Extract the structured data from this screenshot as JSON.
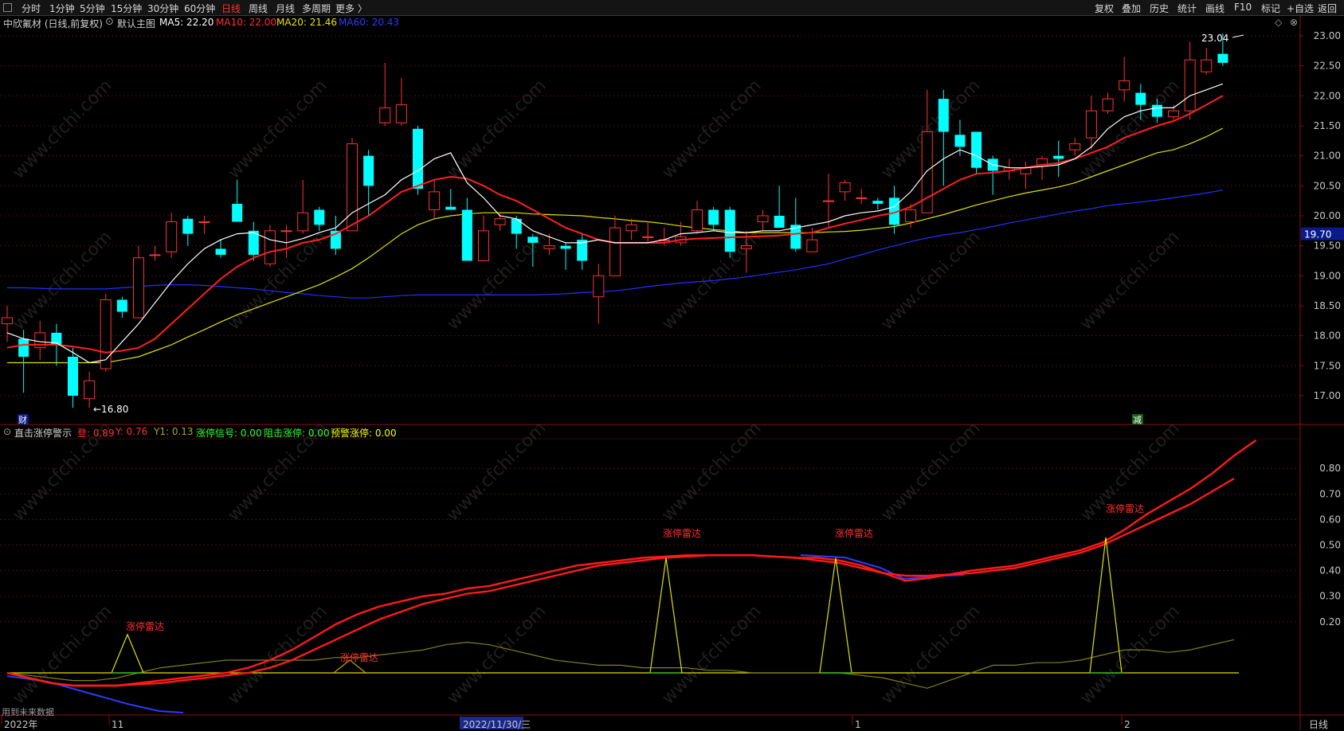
{
  "toolbar": {
    "left": [
      "分时",
      "1分钟",
      "5分钟",
      "15分钟",
      "30分钟",
      "60分钟",
      "日线",
      "周线",
      "月线",
      "多周期",
      "更多 〉"
    ],
    "active": "日线",
    "right": [
      "复权",
      "叠加",
      "历史",
      "统计",
      "画线",
      "F10",
      "标记",
      "+自选",
      "返回"
    ]
  },
  "main_panel": {
    "title": "中欣氟材 (日线,前复权)",
    "indicator": "默认主图",
    "ma5": "MA5: 22.20",
    "ma10": "MA10: 22.00",
    "ma20": "MA20: 21.46",
    "ma60": "MA60: 20.43",
    "price_axis": [
      "23.00",
      "22.50",
      "22.00",
      "21.50",
      "21.00",
      "20.50",
      "20.00",
      "19.50",
      "19.00",
      "18.50",
      "18.00",
      "17.50",
      "17.00"
    ],
    "current_price": "19.70",
    "high_label": "23.04",
    "low_label": "←16.80",
    "markers": [
      "财",
      "减"
    ]
  },
  "sub_panel": {
    "title": "直击涨停警示",
    "params": [
      {
        "text": "登: 0.89",
        "color": "#ff3030"
      },
      {
        "text": "Y: 0.76",
        "color": "#ff3030"
      },
      {
        "text": "Y1: 0.13",
        "color": "#a7a72a"
      },
      {
        "text": "涨停信号: 0.00",
        "color": "#33ff33"
      },
      {
        "text": "阻击涨停: 0.00",
        "color": "#33ff33"
      },
      {
        "text": "预警涨停: 0.00",
        "color": "#ffff00"
      }
    ],
    "axis": [
      "0.80",
      "0.70",
      "0.60",
      "0.50",
      "0.40",
      "0.30",
      "0.20"
    ],
    "signal_label": "涨停雷达",
    "note": "用到未来数据"
  },
  "date_axis": [
    "2022年",
    "11",
    "2022/11/30/三",
    "1",
    "2"
  ],
  "period_badge": "日线",
  "watermark": "www.cfchi.com",
  "colors": {
    "up": "#ff3232",
    "down": "#00ffff",
    "ma5": "#ffffff",
    "ma10": "#ff2020",
    "ma20": "#e0e000",
    "ma60": "#2030ff"
  },
  "chart_data": {
    "type": "candlestick",
    "ylim": [
      16.6,
      23.2
    ],
    "candles": [
      {
        "o": 18.2,
        "c": 18.3,
        "h": 18.5,
        "l": 17.9
      },
      {
        "o": 17.95,
        "c": 17.65,
        "h": 18.1,
        "l": 17.05
      },
      {
        "o": 17.8,
        "c": 18.05,
        "h": 18.25,
        "l": 17.6
      },
      {
        "o": 18.05,
        "c": 17.85,
        "h": 18.2,
        "l": 17.5
      },
      {
        "o": 17.65,
        "c": 17.0,
        "h": 17.8,
        "l": 16.8
      },
      {
        "o": 16.95,
        "c": 17.25,
        "h": 17.4,
        "l": 16.8
      },
      {
        "o": 17.45,
        "c": 18.6,
        "h": 18.7,
        "l": 17.4
      },
      {
        "o": 18.6,
        "c": 18.4,
        "h": 18.65,
        "l": 18.3
      },
      {
        "o": 18.3,
        "c": 19.3,
        "h": 19.5,
        "l": 18.3
      },
      {
        "o": 19.35,
        "c": 19.35,
        "h": 19.5,
        "l": 19.25
      },
      {
        "o": 19.4,
        "c": 19.9,
        "h": 20.05,
        "l": 19.3
      },
      {
        "o": 19.95,
        "c": 19.7,
        "h": 20.0,
        "l": 19.5
      },
      {
        "o": 19.9,
        "c": 19.9,
        "h": 20.0,
        "l": 19.7
      },
      {
        "o": 19.45,
        "c": 19.35,
        "h": 19.6,
        "l": 19.3
      },
      {
        "o": 20.2,
        "c": 19.9,
        "h": 20.6,
        "l": 19.9
      },
      {
        "o": 19.75,
        "c": 19.35,
        "h": 19.9,
        "l": 19.25
      },
      {
        "o": 19.2,
        "c": 19.75,
        "h": 19.85,
        "l": 19.15
      },
      {
        "o": 19.75,
        "c": 19.75,
        "h": 19.85,
        "l": 19.3
      },
      {
        "o": 19.75,
        "c": 20.05,
        "h": 20.6,
        "l": 19.7
      },
      {
        "o": 20.1,
        "c": 19.85,
        "h": 20.15,
        "l": 19.75
      },
      {
        "o": 19.75,
        "c": 19.45,
        "h": 20.0,
        "l": 19.35
      },
      {
        "o": 19.75,
        "c": 21.2,
        "h": 21.3,
        "l": 19.75
      },
      {
        "o": 21.0,
        "c": 20.5,
        "h": 21.1,
        "l": 20.0
      },
      {
        "o": 21.55,
        "c": 21.8,
        "h": 22.55,
        "l": 21.5
      },
      {
        "o": 21.55,
        "c": 21.85,
        "h": 22.3,
        "l": 21.5
      },
      {
        "o": 21.45,
        "c": 20.45,
        "h": 21.5,
        "l": 20.35
      },
      {
        "o": 20.1,
        "c": 20.4,
        "h": 20.6,
        "l": 19.95
      },
      {
        "o": 20.15,
        "c": 20.1,
        "h": 20.45,
        "l": 20.1
      },
      {
        "o": 20.1,
        "c": 19.25,
        "h": 20.3,
        "l": 19.25
      },
      {
        "o": 19.25,
        "c": 19.75,
        "h": 20.0,
        "l": 19.25
      },
      {
        "o": 19.85,
        "c": 19.95,
        "h": 20.05,
        "l": 19.75
      },
      {
        "o": 19.95,
        "c": 19.7,
        "h": 20.0,
        "l": 19.45
      },
      {
        "o": 19.65,
        "c": 19.55,
        "h": 19.7,
        "l": 19.15
      },
      {
        "o": 19.45,
        "c": 19.5,
        "h": 19.7,
        "l": 19.35
      },
      {
        "o": 19.5,
        "c": 19.45,
        "h": 19.55,
        "l": 19.1
      },
      {
        "o": 19.6,
        "c": 19.25,
        "h": 19.7,
        "l": 19.1
      },
      {
        "o": 18.65,
        "c": 19.0,
        "h": 19.2,
        "l": 18.2
      },
      {
        "o": 19.0,
        "c": 19.8,
        "h": 20.0,
        "l": 19.0
      },
      {
        "o": 19.75,
        "c": 19.85,
        "h": 19.95,
        "l": 19.6
      },
      {
        "o": 19.65,
        "c": 19.65,
        "h": 19.9,
        "l": 19.55
      },
      {
        "o": 19.6,
        "c": 19.6,
        "h": 19.8,
        "l": 19.5
      },
      {
        "o": 19.55,
        "c": 19.65,
        "h": 19.9,
        "l": 19.5
      },
      {
        "o": 19.75,
        "c": 20.1,
        "h": 20.25,
        "l": 19.7
      },
      {
        "o": 20.1,
        "c": 19.85,
        "h": 20.15,
        "l": 19.75
      },
      {
        "o": 20.1,
        "c": 19.4,
        "h": 20.15,
        "l": 19.3
      },
      {
        "o": 19.45,
        "c": 19.5,
        "h": 19.75,
        "l": 19.05
      },
      {
        "o": 19.9,
        "c": 20.0,
        "h": 20.1,
        "l": 19.75
      },
      {
        "o": 20.0,
        "c": 19.8,
        "h": 20.5,
        "l": 19.8
      },
      {
        "o": 19.85,
        "c": 19.45,
        "h": 20.3,
        "l": 19.4
      },
      {
        "o": 19.4,
        "c": 19.6,
        "h": 19.8,
        "l": 19.4
      },
      {
        "o": 20.25,
        "c": 20.25,
        "h": 20.7,
        "l": 19.8
      },
      {
        "o": 20.4,
        "c": 20.55,
        "h": 20.6,
        "l": 20.25
      },
      {
        "o": 20.3,
        "c": 20.3,
        "h": 20.45,
        "l": 20.2
      },
      {
        "o": 20.25,
        "c": 20.2,
        "h": 20.3,
        "l": 20.1
      },
      {
        "o": 20.3,
        "c": 19.85,
        "h": 20.5,
        "l": 19.7
      },
      {
        "o": 19.9,
        "c": 20.1,
        "h": 20.2,
        "l": 19.8
      },
      {
        "o": 20.05,
        "c": 21.4,
        "h": 22.1,
        "l": 20.05
      },
      {
        "o": 21.95,
        "c": 21.4,
        "h": 22.1,
        "l": 20.5
      },
      {
        "o": 21.35,
        "c": 21.15,
        "h": 21.6,
        "l": 21.0
      },
      {
        "o": 21.4,
        "c": 20.8,
        "h": 21.4,
        "l": 20.7
      },
      {
        "o": 20.95,
        "c": 20.75,
        "h": 21.0,
        "l": 20.35
      },
      {
        "o": 20.75,
        "c": 20.8,
        "h": 20.95,
        "l": 20.6
      },
      {
        "o": 20.7,
        "c": 20.8,
        "h": 20.9,
        "l": 20.45
      },
      {
        "o": 20.85,
        "c": 20.95,
        "h": 21.0,
        "l": 20.6
      },
      {
        "o": 21.0,
        "c": 20.95,
        "h": 21.25,
        "l": 20.65
      },
      {
        "o": 21.1,
        "c": 21.2,
        "h": 21.3,
        "l": 21.0
      },
      {
        "o": 21.3,
        "c": 21.75,
        "h": 22.0,
        "l": 21.1
      },
      {
        "o": 21.75,
        "c": 21.95,
        "h": 22.05,
        "l": 21.7
      },
      {
        "o": 22.1,
        "c": 22.25,
        "h": 22.65,
        "l": 21.9
      },
      {
        "o": 22.05,
        "c": 21.85,
        "h": 22.2,
        "l": 21.6
      },
      {
        "o": 21.85,
        "c": 21.65,
        "h": 21.95,
        "l": 21.55
      },
      {
        "o": 21.65,
        "c": 21.75,
        "h": 21.85,
        "l": 21.6
      },
      {
        "o": 21.75,
        "c": 22.6,
        "h": 22.9,
        "l": 21.6
      },
      {
        "o": 22.4,
        "c": 22.6,
        "h": 22.8,
        "l": 22.35
      },
      {
        "o": 22.7,
        "c": 22.55,
        "h": 23.04,
        "l": 22.5
      }
    ],
    "ma5": [
      18.05,
      17.95,
      17.9,
      17.88,
      17.72,
      17.55,
      17.6,
      17.9,
      18.2,
      18.55,
      18.9,
      19.2,
      19.45,
      19.6,
      19.7,
      19.72,
      19.6,
      19.55,
      19.62,
      19.72,
      19.8,
      20.05,
      20.2,
      20.35,
      20.6,
      20.75,
      20.95,
      21.05,
      20.55,
      20.3,
      20.0,
      19.95,
      19.75,
      19.65,
      19.55,
      19.55,
      19.6,
      19.55,
      19.55,
      19.55,
      19.6,
      19.7,
      19.72,
      19.75,
      19.72,
      19.72,
      19.75,
      19.75,
      19.8,
      19.85,
      19.9,
      20.0,
      20.05,
      20.08,
      20.15,
      20.4,
      20.75,
      20.95,
      21.1,
      21.0,
      20.85,
      20.8,
      20.8,
      20.82,
      20.85,
      20.95,
      21.15,
      21.45,
      21.65,
      21.75,
      21.8,
      21.8,
      22.0,
      22.1,
      22.2
    ],
    "ma10": [
      17.8,
      17.85,
      17.85,
      17.85,
      17.82,
      17.78,
      17.72,
      17.75,
      17.8,
      17.95,
      18.2,
      18.45,
      18.7,
      18.95,
      19.15,
      19.3,
      19.4,
      19.45,
      19.55,
      19.6,
      19.7,
      19.85,
      20.0,
      20.2,
      20.4,
      20.5,
      20.6,
      20.65,
      20.62,
      20.5,
      20.35,
      20.25,
      20.1,
      19.95,
      19.8,
      19.7,
      19.6,
      19.55,
      19.55,
      19.55,
      19.55,
      19.6,
      19.62,
      19.63,
      19.64,
      19.65,
      19.66,
      19.67,
      19.7,
      19.72,
      19.8,
      19.87,
      19.93,
      20.0,
      20.05,
      20.15,
      20.3,
      20.45,
      20.6,
      20.7,
      20.72,
      20.75,
      20.8,
      20.85,
      20.88,
      20.95,
      21.05,
      21.15,
      21.3,
      21.4,
      21.5,
      21.58,
      21.7,
      21.85,
      22.0
    ],
    "ma20": [
      17.55,
      17.55,
      17.55,
      17.55,
      17.55,
      17.55,
      17.55,
      17.6,
      17.65,
      17.75,
      17.85,
      17.98,
      18.1,
      18.23,
      18.35,
      18.45,
      18.55,
      18.65,
      18.75,
      18.85,
      18.98,
      19.12,
      19.3,
      19.5,
      19.7,
      19.85,
      19.95,
      20.0,
      20.03,
      20.05,
      20.05,
      20.05,
      20.03,
      20.02,
      20.01,
      20.0,
      19.97,
      19.95,
      19.92,
      19.9,
      19.87,
      19.83,
      19.8,
      19.77,
      19.75,
      19.72,
      19.72,
      19.72,
      19.72,
      19.72,
      19.73,
      19.74,
      19.76,
      19.79,
      19.82,
      19.88,
      19.95,
      20.02,
      20.1,
      20.18,
      20.25,
      20.32,
      20.38,
      20.43,
      20.48,
      20.55,
      20.65,
      20.75,
      20.85,
      20.95,
      21.05,
      21.1,
      21.2,
      21.32,
      21.46
    ],
    "ma60": [
      18.8,
      18.8,
      18.79,
      18.78,
      18.78,
      18.78,
      18.78,
      18.8,
      18.82,
      18.84,
      18.85,
      18.85,
      18.84,
      18.82,
      18.8,
      18.78,
      18.75,
      18.72,
      18.7,
      18.67,
      18.65,
      18.63,
      18.63,
      18.65,
      18.67,
      18.68,
      18.68,
      18.68,
      18.68,
      18.68,
      18.68,
      18.68,
      18.68,
      18.69,
      18.7,
      18.72,
      18.73,
      18.75,
      18.78,
      18.82,
      18.85,
      18.88,
      18.9,
      18.92,
      18.95,
      18.98,
      19.02,
      19.06,
      19.1,
      19.15,
      19.2,
      19.28,
      19.35,
      19.43,
      19.5,
      19.57,
      19.63,
      19.68,
      19.72,
      19.77,
      19.82,
      19.88,
      19.93,
      19.98,
      20.03,
      20.08,
      20.12,
      20.17,
      20.2,
      20.23,
      20.26,
      20.3,
      20.34,
      20.38,
      20.43
    ]
  },
  "indicator_data": {
    "ylim": [
      -0.05,
      0.92
    ],
    "red1": [
      0.0,
      -0.02,
      -0.04,
      -0.05,
      -0.05,
      -0.05,
      -0.04,
      -0.03,
      -0.02,
      -0.01,
      0.0,
      0.02,
      0.05,
      0.09,
      0.14,
      0.19,
      0.23,
      0.26,
      0.28,
      0.3,
      0.31,
      0.33,
      0.34,
      0.36,
      0.38,
      0.4,
      0.42,
      0.43,
      0.44,
      0.45,
      0.455,
      0.46,
      0.46,
      0.46,
      0.46,
      0.455,
      0.45,
      0.45,
      0.44,
      0.42,
      0.39,
      0.36,
      0.37,
      0.385,
      0.4,
      0.41,
      0.42,
      0.44,
      0.46,
      0.48,
      0.51,
      0.56,
      0.62,
      0.67,
      0.72,
      0.78,
      0.85,
      0.91
    ],
    "red2": [
      0.0,
      -0.02,
      -0.04,
      -0.05,
      -0.05,
      -0.05,
      -0.045,
      -0.04,
      -0.03,
      -0.02,
      -0.01,
      0.0,
      0.02,
      0.05,
      0.09,
      0.13,
      0.17,
      0.21,
      0.24,
      0.27,
      0.29,
      0.31,
      0.32,
      0.34,
      0.36,
      0.38,
      0.4,
      0.42,
      0.43,
      0.44,
      0.45,
      0.455,
      0.46,
      0.46,
      0.46,
      0.455,
      0.45,
      0.44,
      0.43,
      0.41,
      0.39,
      0.38,
      0.38,
      0.385,
      0.39,
      0.4,
      0.41,
      0.43,
      0.45,
      0.47,
      0.5,
      0.54,
      0.58,
      0.62,
      0.66,
      0.71,
      0.76
    ]
  }
}
